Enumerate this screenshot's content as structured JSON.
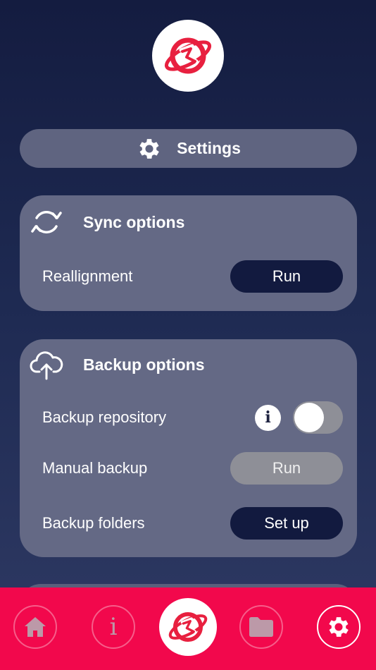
{
  "header": {
    "logo": "app-logo"
  },
  "settings_bar": {
    "label": "Settings",
    "icon": "gear-icon"
  },
  "sync": {
    "title": "Sync options",
    "icon": "sync-arrows-icon",
    "reallignment_label": "Reallignment",
    "reallignment_button": "Run"
  },
  "backup": {
    "title": "Backup options",
    "icon": "cloud-upload-icon",
    "repository_label": "Backup repository",
    "repository_info_glyph": "i",
    "repository_enabled": false,
    "manual_label": "Manual backup",
    "manual_button": "Run",
    "folders_label": "Backup folders",
    "folders_button": "Set up"
  },
  "tabbar": {
    "items": [
      {
        "name": "home",
        "icon": "home-icon",
        "active": false
      },
      {
        "name": "info",
        "icon": "info-icon",
        "glyph": "i",
        "active": false
      },
      {
        "name": "center",
        "icon": "app-logo",
        "active": false
      },
      {
        "name": "files",
        "icon": "folder-icon",
        "active": false
      },
      {
        "name": "settings",
        "icon": "gear-icon",
        "active": true
      }
    ]
  },
  "colors": {
    "accent": "#f2084c",
    "logo_red": "#e8203f",
    "button_dark": "#121a3f",
    "card": "#646985"
  }
}
